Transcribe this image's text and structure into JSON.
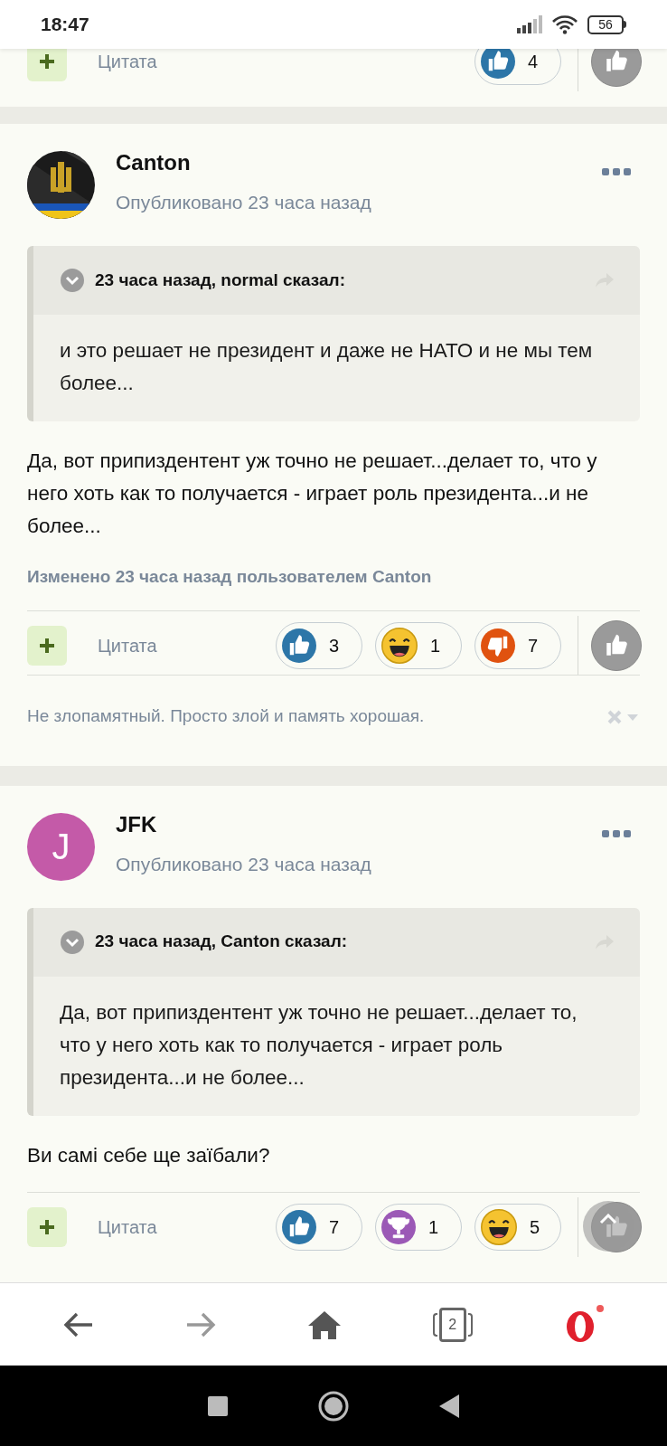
{
  "status_bar": {
    "time": "18:47",
    "battery": "56"
  },
  "previous_post_footer": {
    "quote_label": "Цитата",
    "reactions": [
      {
        "kind": "like",
        "count": "4"
      }
    ]
  },
  "posts": [
    {
      "author": "Canton",
      "published": "Опубликовано 23 часа назад",
      "quote": {
        "header": "23 часа назад, normal сказал:",
        "text": "и это решает не президент и даже не НАТО и не мы тем более..."
      },
      "body": "Да, вот припиздентент уж точно не решает...делает то, что у него хоть как то получается - играет роль президента...и не более...",
      "edited": "Изменено 23 часа назад пользователем Canton",
      "quote_label": "Цитата",
      "reactions": [
        {
          "kind": "like",
          "count": "3"
        },
        {
          "kind": "haha",
          "count": "1"
        },
        {
          "kind": "dislike",
          "count": "7"
        }
      ],
      "signature": "Не злопамятный. Просто злой и память хорошая."
    },
    {
      "author": "JFK",
      "avatar": {
        "kind": "letter",
        "letter": "J",
        "color": "#c45aa8"
      },
      "published": "Опубликовано 23 часа назад",
      "quote": {
        "header": "23 часа назад, Canton сказал:",
        "text": "Да, вот припиздентент уж точно не решает...делает то, что у него хоть как то получается - играет роль президента...и не более..."
      },
      "body": "Ви самі себе ще заїбали?",
      "quote_label": "Цитата",
      "reactions": [
        {
          "kind": "like",
          "count": "7"
        },
        {
          "kind": "trophy",
          "count": "1"
        },
        {
          "kind": "haha",
          "count": "5"
        }
      ]
    }
  ],
  "browser_nav": {
    "tab_count": "2"
  }
}
